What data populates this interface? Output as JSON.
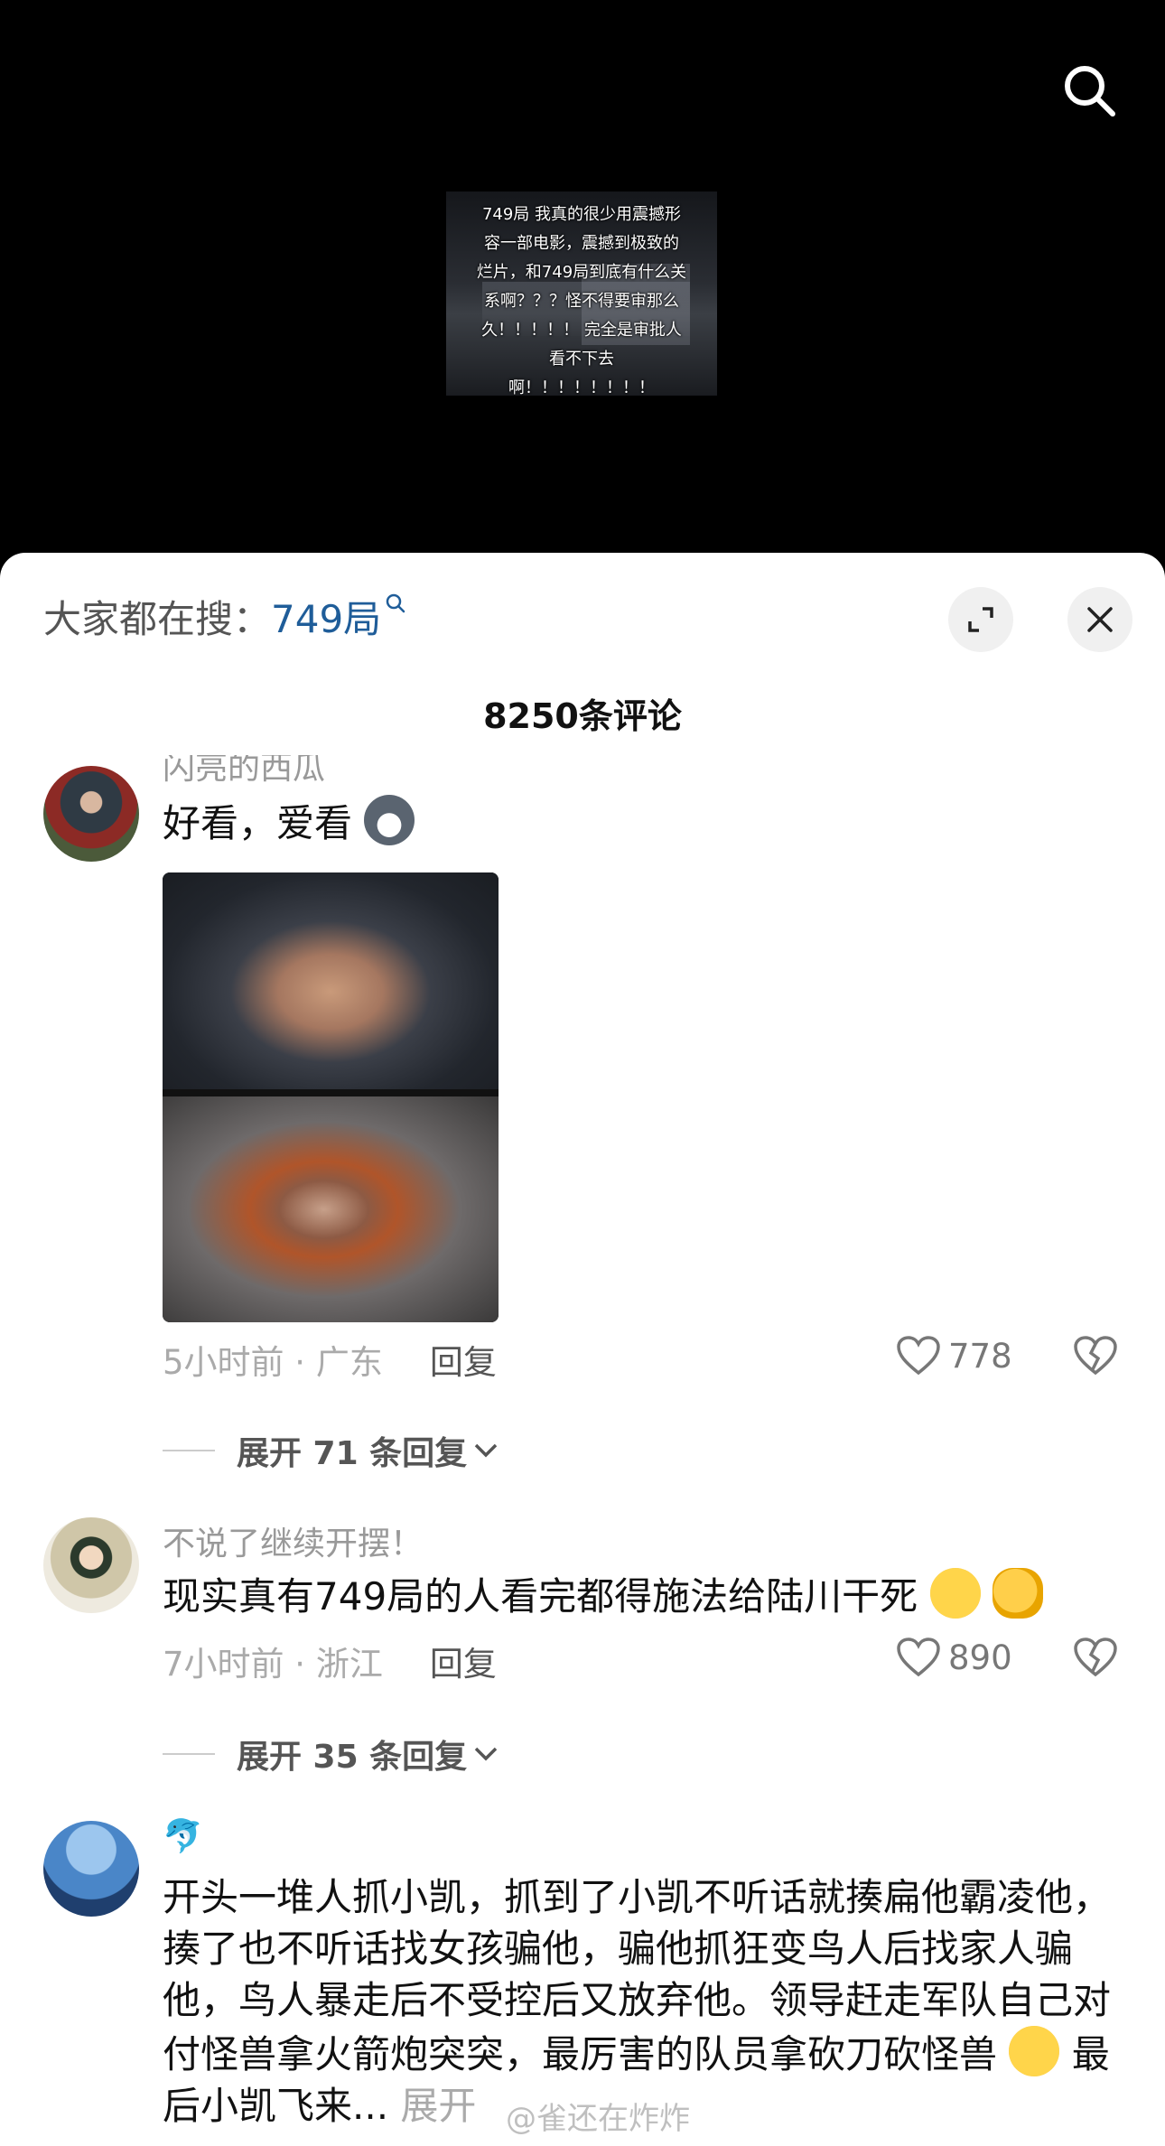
{
  "video": {
    "caption": "749局 我真的很少用震撼形\n容一部电影，震撼到极致的\n烂片，和749局到底有什么关\n系啊？？？怪不得要审那么\n久！！！！！ 完全是审批人\n看不下去\n啊！！！！！！！！"
  },
  "sheet": {
    "hot_search_prefix": "大家都在搜：",
    "hot_search_term": "749局",
    "comment_count": "8250条评论"
  },
  "comments": [
    {
      "username": "闪亮的西瓜",
      "text": "好看，爱看",
      "time_location": "5小时前 · 广东",
      "reply_label": "回复",
      "likes": "778",
      "expand_label": "展开 71 条回复"
    },
    {
      "username": "不说了继续开摆！",
      "text": "现实真有749局的人看完都得施法给陆川干死",
      "time_location": "7小时前 · 浙江",
      "reply_label": "回复",
      "likes": "890",
      "expand_label": "展开 35 条回复"
    },
    {
      "username": "🐬",
      "text": "开头一堆人抓小凯，抓到了小凯不听话就揍扁他霸凌他，揍了也不听话找女孩骗他，骗他抓狂变鸟人后找家人骗他，鸟人暴走后不受控后又放弃他。领导赶走军队自己对付怪兽拿火箭炮突突，最厉害的队员拿砍刀砍怪兽",
      "text_tail": "最后小凯飞来...",
      "expand_more": "展开"
    }
  ],
  "watermark": "@雀还在炸炸",
  "icons": {
    "search": "search-icon",
    "expand": "expand-icon",
    "close": "close-icon",
    "heart": "heart-icon",
    "dislike": "broken-heart-icon",
    "chevron": "chevron-down-icon"
  }
}
